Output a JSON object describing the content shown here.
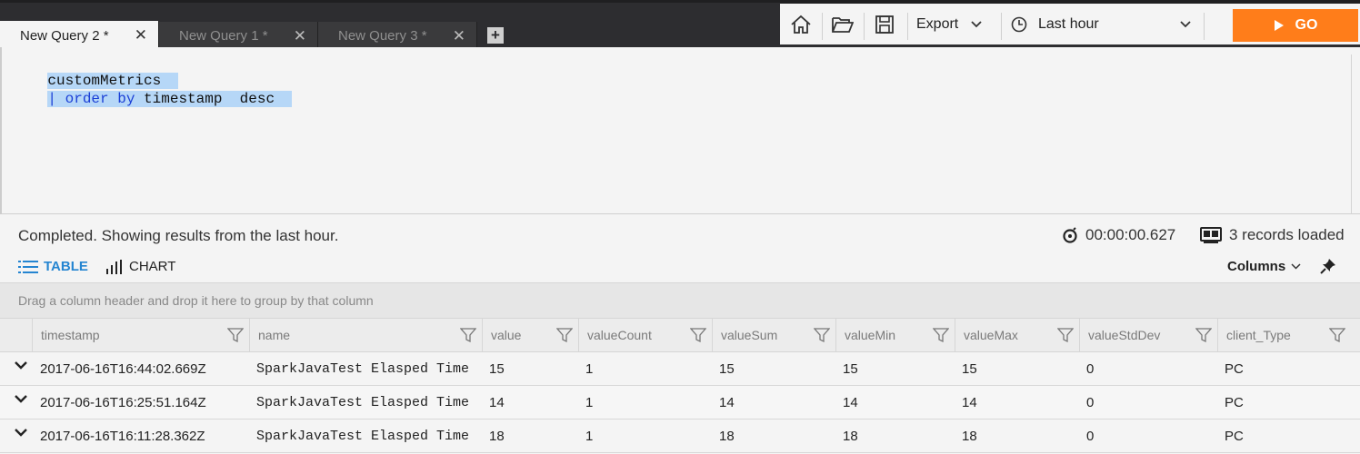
{
  "tabs": [
    {
      "label": "New Query 2 *",
      "active": true
    },
    {
      "label": "New Query 1 *",
      "active": false
    },
    {
      "label": "New Query 3 *",
      "active": false
    }
  ],
  "add_tab_label": "+",
  "toolbar": {
    "export_label": "Export",
    "time_range": "Last hour",
    "go_label": "GO",
    "go_color": "#ff7d1a"
  },
  "editor": {
    "line1": "customMetrics",
    "line2_pipe": "|",
    "line2_kw": "order by",
    "line2_rest": "timestamp  desc"
  },
  "status": {
    "message": "Completed. Showing results from the last hour.",
    "elapsed": "00:00:00.627",
    "records": "3 records loaded"
  },
  "views": {
    "table_label": "TABLE",
    "chart_label": "CHART",
    "columns_label": "Columns"
  },
  "group_panel_text": "Drag a column header and drop it here to group by that column",
  "columns": [
    "timestamp",
    "name",
    "value",
    "valueCount",
    "valueSum",
    "valueMin",
    "valueMax",
    "valueStdDev",
    "client_Type"
  ],
  "rows": [
    [
      "2017-06-16T16:44:02.669Z",
      "SparkJavaTest Elasped Time",
      "15",
      "1",
      "15",
      "15",
      "15",
      "0",
      "PC"
    ],
    [
      "2017-06-16T16:25:51.164Z",
      "SparkJavaTest Elasped Time",
      "14",
      "1",
      "14",
      "14",
      "14",
      "0",
      "PC"
    ],
    [
      "2017-06-16T16:11:28.362Z",
      "SparkJavaTest Elasped Time",
      "18",
      "1",
      "18",
      "18",
      "18",
      "0",
      "PC"
    ]
  ],
  "accent_color": "#2585d1"
}
